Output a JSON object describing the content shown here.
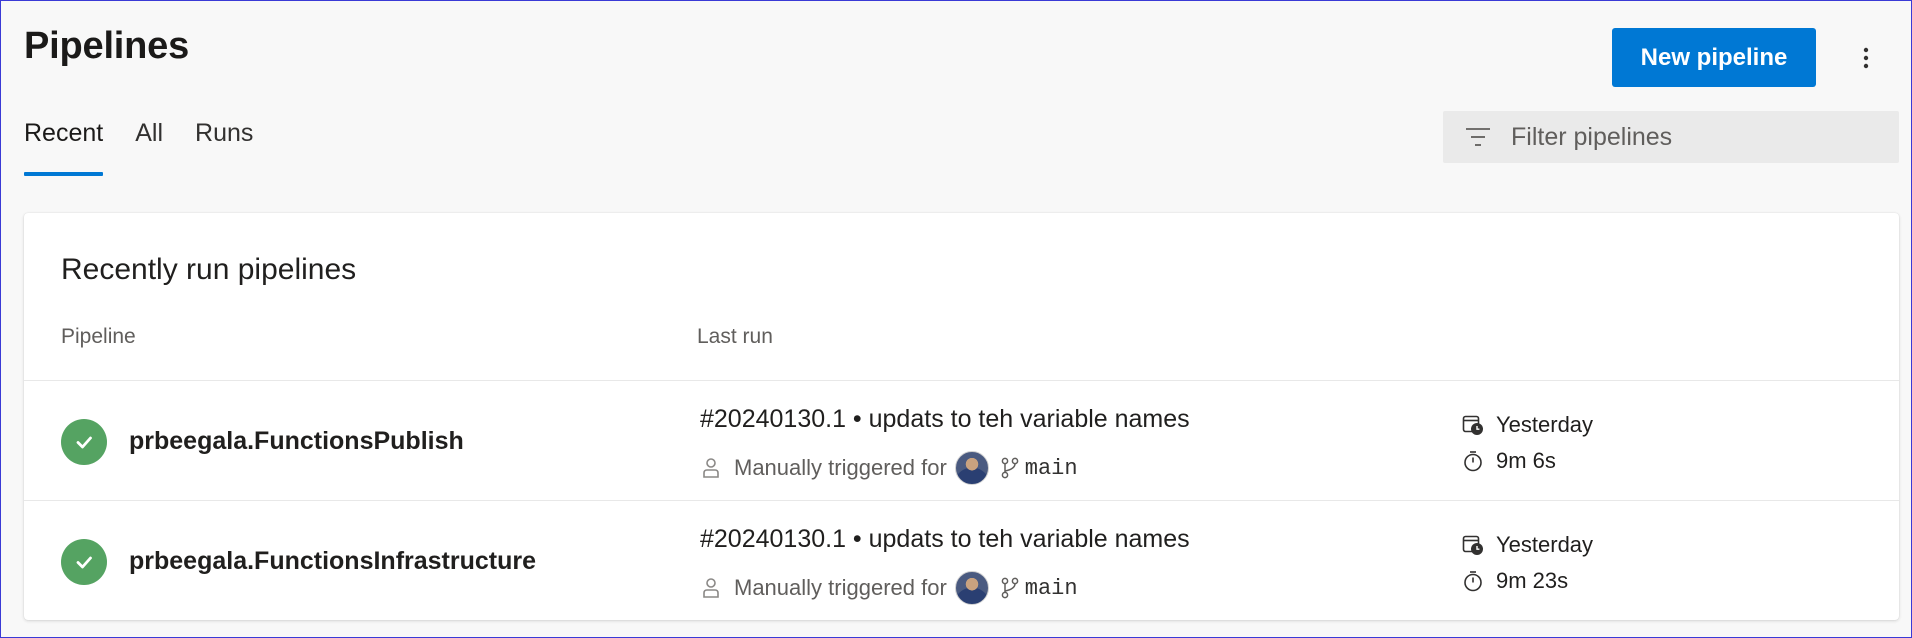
{
  "header": {
    "title": "Pipelines",
    "new_button": "New pipeline",
    "more_icon": "more-vertical-icon"
  },
  "tabs": [
    {
      "label": "Recent",
      "active": true
    },
    {
      "label": "All",
      "active": false
    },
    {
      "label": "Runs",
      "active": false
    }
  ],
  "filter": {
    "placeholder": "Filter pipelines",
    "icon": "filter-icon"
  },
  "card": {
    "title": "Recently run pipelines",
    "columns": {
      "pipeline": "Pipeline",
      "last_run": "Last run"
    },
    "rows": [
      {
        "status": "succeeded",
        "name": "prbeegala.FunctionsPublish",
        "run_title": "#20240130.1 • updats to teh variable names",
        "trigger": "Manually triggered for",
        "branch": "main",
        "when": "Yesterday",
        "duration": "9m 6s"
      },
      {
        "status": "succeeded",
        "name": "prbeegala.FunctionsInfrastructure",
        "run_title": "#20240130.1 • updats to teh variable names",
        "trigger": "Manually triggered for",
        "branch": "main",
        "when": "Yesterday",
        "duration": "9m 23s"
      }
    ]
  },
  "colors": {
    "accent": "#0078d4",
    "success": "#55a362"
  }
}
